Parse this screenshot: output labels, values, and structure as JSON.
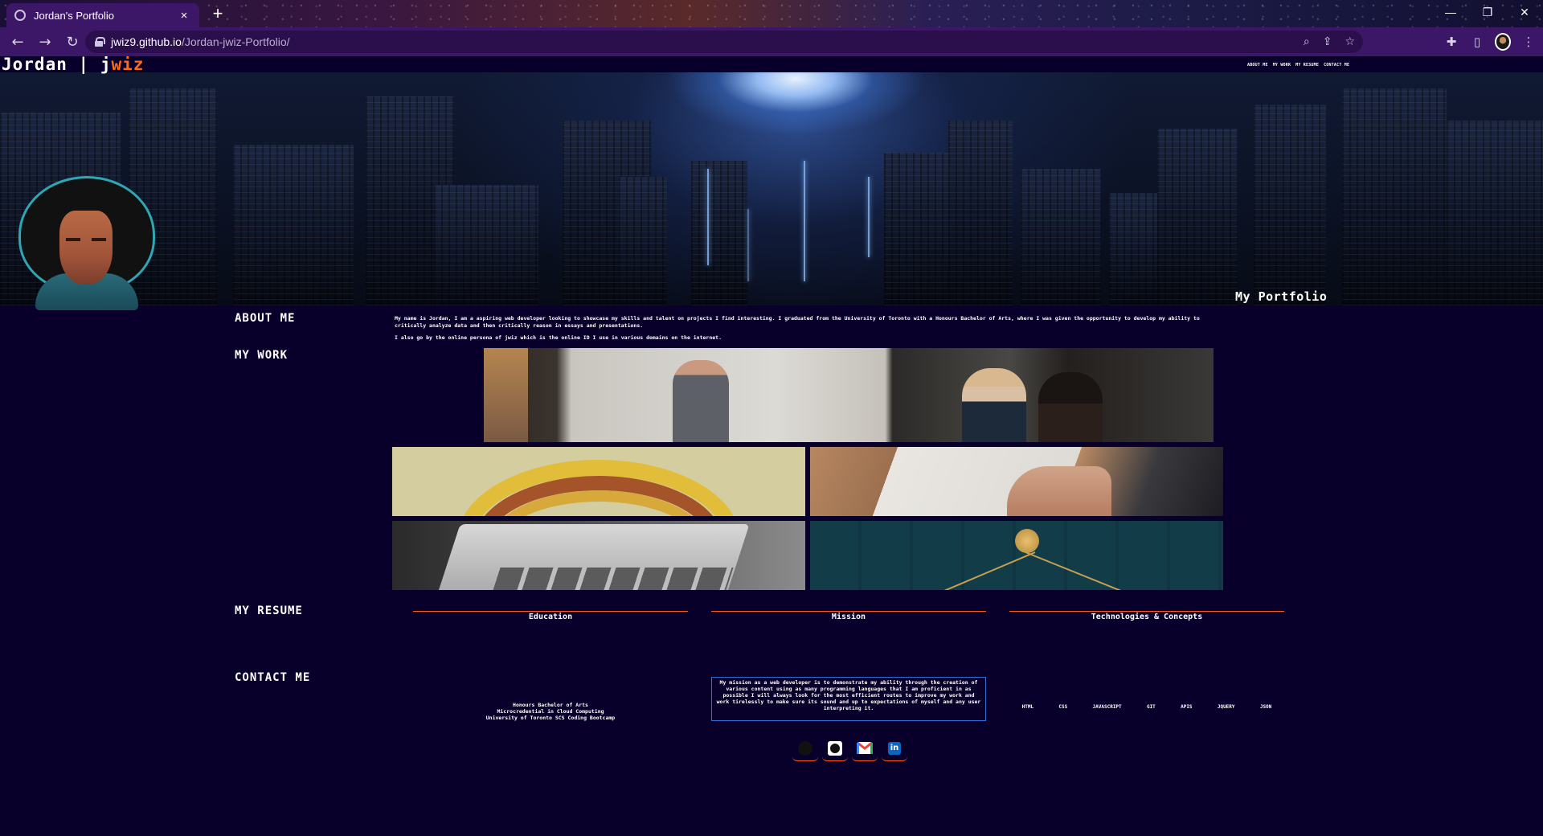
{
  "browser": {
    "tab_title": "Jordan's Portfolio",
    "tab_close": "×",
    "new_tab": "+",
    "url_host": "jwiz9.github.io",
    "url_path": "/Jordan-jwiz-Portfolio/",
    "window_controls": [
      "—",
      "❐",
      "✕"
    ],
    "nav_icons": [
      "arrow-left-icon",
      "arrow-right-icon",
      "reload-icon"
    ],
    "omnibox_icons": [
      "zoom-icon",
      "share-icon",
      "bookmark-star-icon"
    ],
    "toolbar_icons": [
      "extensions-icon",
      "side-panel-icon",
      "profile-avatar",
      "menu-icon"
    ]
  },
  "site": {
    "title_name": "Jordan",
    "title_sep": "|",
    "title_j": "j",
    "title_wiz": "wiz",
    "nav": [
      "ABOUT ME",
      "MY WORK",
      "MY RESUME",
      "CONTACT ME"
    ],
    "hero_caption": "My Portfolio"
  },
  "about": {
    "heading": "ABOUT ME",
    "p1": "My name is Jordan, I am a aspiring web developer looking to showcase my skills and talent on projects I find interesting. I graduated from the University of Toronto with a Honours Bachelor of Arts, where I was given the opportunity to develop my ability to critically analyze data and then critically reason in essays and presentations.",
    "p2": "I also go by the online persona of jwiz which is the online ID I use in various domains on the internet."
  },
  "work": {
    "heading": "MY WORK"
  },
  "resume": {
    "heading": "MY RESUME",
    "education_title": "Education",
    "education_items": [
      "Honours Bachelor of Arts",
      "Microcredential in Cloud Computing",
      "University of Toronto SCS Coding Bootcamp"
    ],
    "mission_title": "Mission",
    "mission_text": "My mission as a web developer is to demonstrate my ability through the creation of various content using as many programming languages that I am proficient in as possible I will always look for the most efficient routes to improve my work and work tirelessly to make sure its sound and up to expectations of myself and any user interpreting it.",
    "tech_title": "Technologies & Concepts",
    "tech_items": [
      "HTML",
      "CSS",
      "JAVASCRIPT",
      "GIT",
      "APIS",
      "JQUERY",
      "JSON"
    ]
  },
  "contact": {
    "heading": "CONTACT ME",
    "icons": [
      "stackoverflow-icon",
      "github-icon",
      "gmail-icon",
      "linkedin-icon"
    ],
    "linkedin_label": "in"
  },
  "colors": {
    "page_bg": "#08002a",
    "accent_orange": "#ff6a1a",
    "mission_border": "#2d6fd6",
    "browser_purple": "#3d1767"
  }
}
